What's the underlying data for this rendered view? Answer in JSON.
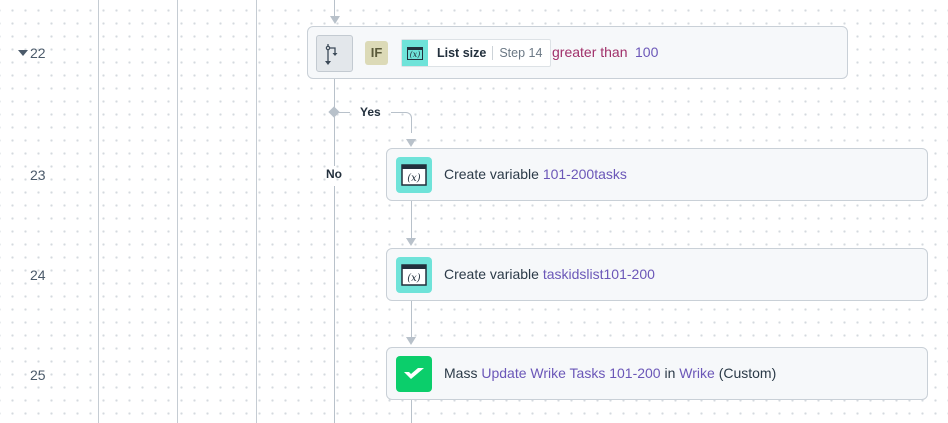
{
  "line_numbers": [
    "22",
    "23",
    "24",
    "25"
  ],
  "if_step": {
    "badge": "IF",
    "field_label": "List size",
    "field_step": "Step 14",
    "operator": "greater than",
    "value": "100"
  },
  "branches": {
    "yes": "Yes",
    "no": "No"
  },
  "steps": [
    {
      "prefix": "Create variable ",
      "name": "101-200tasks",
      "icon": "variable-icon"
    },
    {
      "prefix": "Create variable ",
      "name": "taskidslist101-200",
      "icon": "variable-icon"
    },
    {
      "prefix": "Mass ",
      "action": "Update Wrike Tasks 101-200",
      "mid": " in ",
      "app": "Wrike",
      "suffix": " (Custom)",
      "icon": "wrike-check-icon"
    }
  ],
  "colors": {
    "accent_purple": "#6b57b8",
    "operator": "#a0306a",
    "variable_icon": "#6fe3d9",
    "wrike_green": "#0bce6b"
  }
}
